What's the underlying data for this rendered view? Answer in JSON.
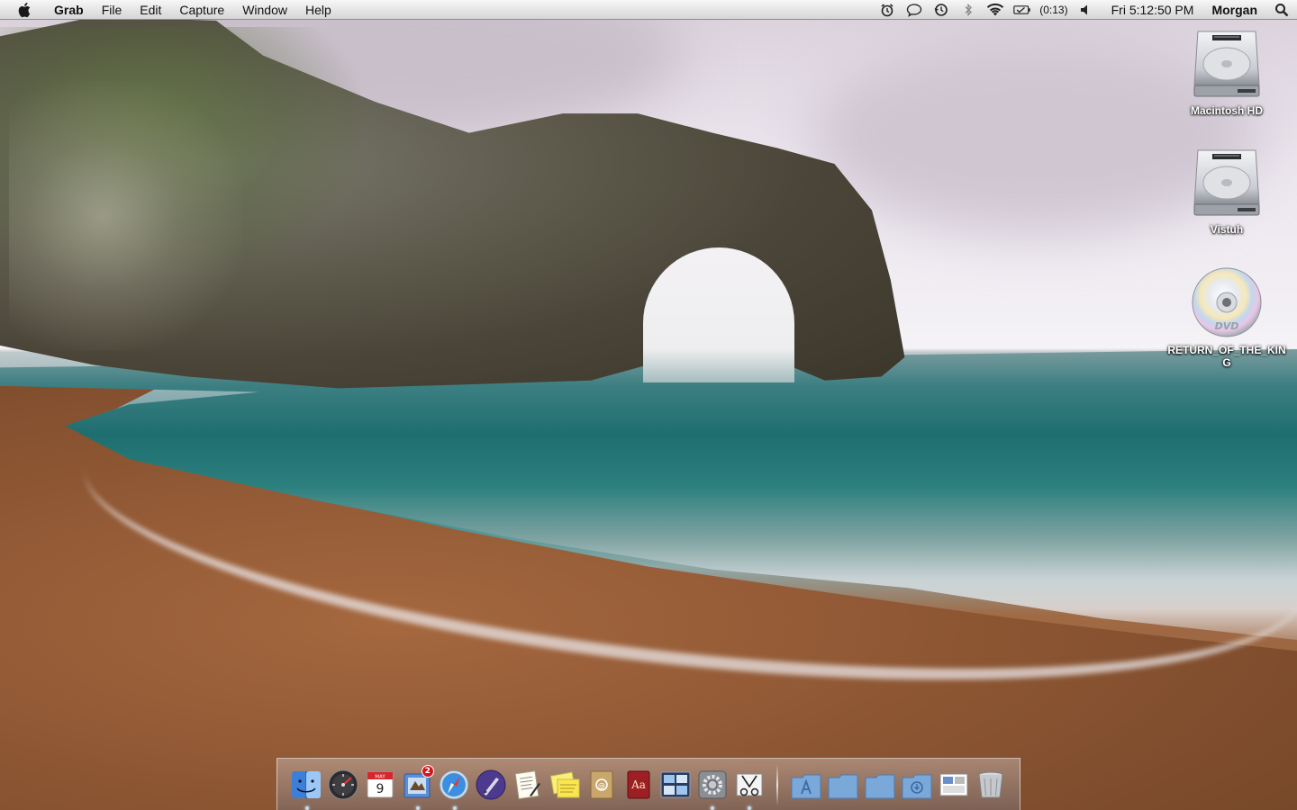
{
  "menubar": {
    "app_name": "Grab",
    "menus": [
      "File",
      "Edit",
      "Capture",
      "Window",
      "Help"
    ],
    "battery_time": "(0:13)",
    "clock": "Fri 5:12:50 PM",
    "user": "Morgan"
  },
  "desktop": {
    "icons": [
      {
        "label": "Macintosh HD",
        "icon": "hard-drive-icon"
      },
      {
        "label": "Vistuh",
        "icon": "hard-drive-icon"
      },
      {
        "label": "RETURN_OF_THE_KING",
        "icon": "dvd-icon"
      }
    ]
  },
  "dock": {
    "apps": [
      {
        "name": "finder",
        "icon": "finder-icon",
        "running": true
      },
      {
        "name": "dashboard",
        "icon": "dashboard-icon",
        "running": false
      },
      {
        "name": "ical",
        "icon": "calendar-icon",
        "running": false,
        "month": "MAY",
        "day": "9"
      },
      {
        "name": "mail",
        "icon": "mail-icon",
        "running": true,
        "badge": "2"
      },
      {
        "name": "safari",
        "icon": "safari-icon",
        "running": true
      },
      {
        "name": "pen-app",
        "icon": "pen-icon",
        "running": false
      },
      {
        "name": "textedit",
        "icon": "textedit-icon",
        "running": false
      },
      {
        "name": "stickies",
        "icon": "stickies-icon",
        "running": false
      },
      {
        "name": "address-book",
        "icon": "address-book-icon",
        "running": false
      },
      {
        "name": "dictionary",
        "icon": "dictionary-icon",
        "running": false,
        "glyph": "Aa"
      },
      {
        "name": "expose",
        "icon": "expose-icon",
        "running": false
      },
      {
        "name": "system-preferences",
        "icon": "gear-icon",
        "running": true
      },
      {
        "name": "grab",
        "icon": "grab-icon",
        "running": true
      }
    ],
    "stacks": [
      {
        "name": "applications",
        "icon": "applications-folder-icon"
      },
      {
        "name": "documents",
        "icon": "folder-icon"
      },
      {
        "name": "downloads",
        "icon": "folder-icon"
      },
      {
        "name": "user-folder",
        "icon": "downloads-folder-icon"
      },
      {
        "name": "screenshots",
        "icon": "screenshots-icon"
      },
      {
        "name": "trash",
        "icon": "trash-icon"
      }
    ]
  },
  "colors": {
    "menubar_top": "#f7f7f7",
    "menubar_bottom": "#d6d6d6",
    "badge_red": "#d2161c",
    "sea": "#2c807e",
    "beach": "#8d5633"
  }
}
